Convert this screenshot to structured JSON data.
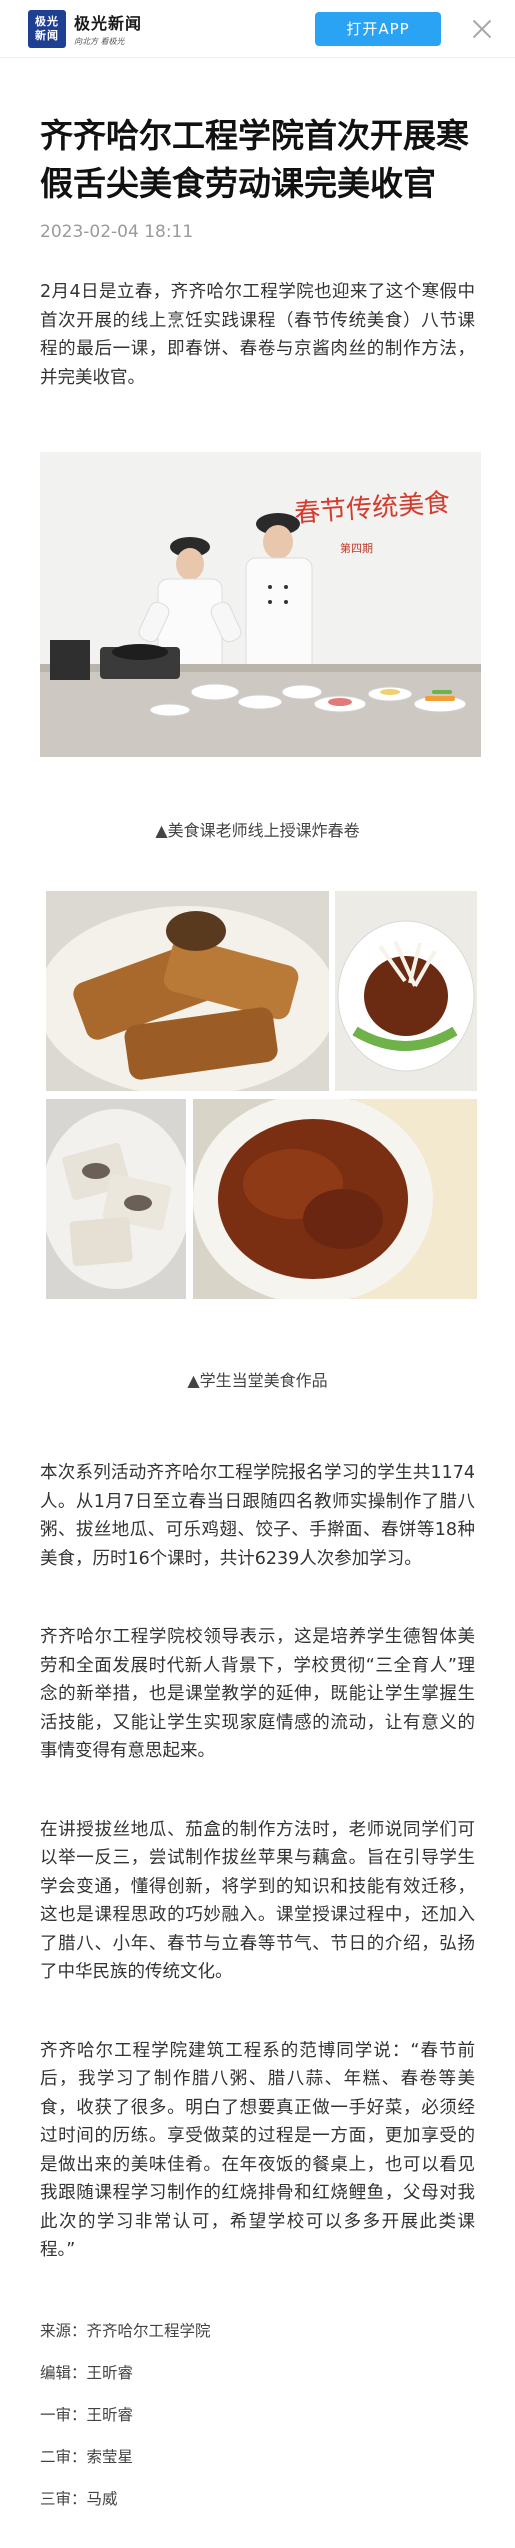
{
  "topbar": {
    "logo_mark": "极光新闻",
    "logo_name": "极光新闻",
    "logo_slogan": "向北方 看极光",
    "open_app_label": "打开APP",
    "close_icon": "close-icon"
  },
  "article": {
    "title": "齐齐哈尔工程学院首次开展寒假舌尖美食劳动课完美收官",
    "date": "2023-02-04 18:11",
    "paragraph_1": "2月4日是立春，齐齐哈尔工程学院也迎来了这个寒假中首次开展的线上烹饪实践课程（春节传统美食）八节课程的最后一课，即春饼、春卷与京酱肉丝的制作方法，并完美收官。",
    "image_1": {
      "banner_text": "春节传统美食",
      "banner_sub": "第四期"
    },
    "caption_1": "▲美食课老师线上授课炸春卷",
    "caption_2": "▲学生当堂美食作品",
    "paragraph_2": "本次系列活动齐齐哈尔工程学院报名学习的学生共1174人。从1月7日至立春当日跟随四名教师实操制作了腊八粥、拔丝地瓜、可乐鸡翅、饺子、手擀面、春饼等18种美食，历时16个课时，共计6239人次参加学习。",
    "paragraph_3": "齐齐哈尔工程学院校领导表示，这是培养学生德智体美劳和全面发展时代新人背景下，学校贯彻“三全育人”理念的新举措，也是课堂教学的延伸，既能让学生掌握生活技能，又能让学生实现家庭情感的流动，让有意义的事情变得有意思起来。",
    "paragraph_4": "在讲授拔丝地瓜、茄盒的制作方法时，老师说同学们可以举一反三，尝试制作拔丝苹果与藕盒。旨在引导学生学会变通，懂得创新，将学到的知识和技能有效迁移，这也是课程思政的巧妙融入。课堂授课过程中，还加入了腊八、小年、春节与立春等节气、节日的介绍，弘扬了中华民族的传统文化。",
    "paragraph_5": "齐齐哈尔工程学院建筑工程系的范博同学说：“春节前后，我学习了制作腊八粥、腊八蒜、年糕、春卷等美食，收获了很多。明白了想要真正做一手好菜，必须经过时间的历练。享受做菜的过程是一方面，更加享受的是做出来的美味佳肴。在年夜饭的餐桌上，也可以看见我跟随课程学习制作的红烧排骨和红烧鲤鱼，父母对我此次的学习非常认可，希望学校可以多多开展此类课程。”",
    "credits": [
      "来源：齐齐哈尔工程学院",
      "编辑：王昕睿",
      "一审：王昕睿",
      "二审：索莹星",
      "三审：马威"
    ]
  }
}
